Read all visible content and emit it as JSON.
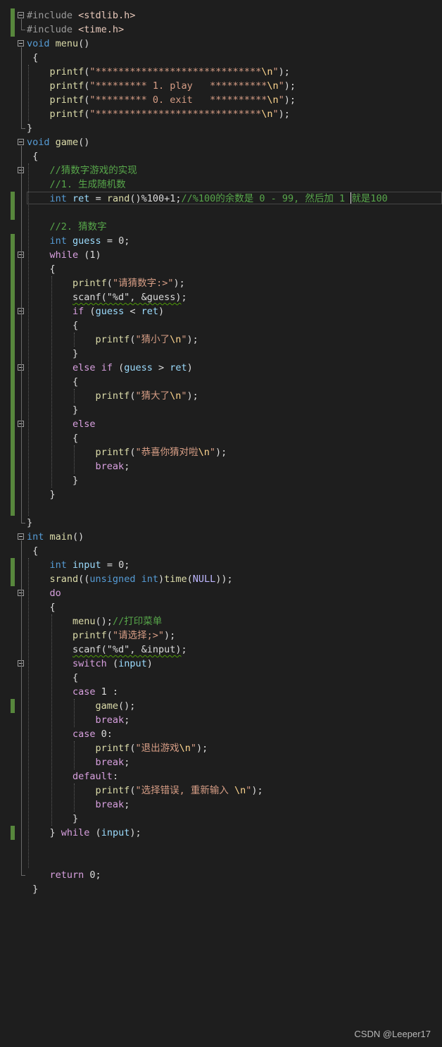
{
  "lines": [
    {
      "tokens": [
        {
          "t": "#include ",
          "c": "pp"
        },
        {
          "t": "<stdlib.h>",
          "c": "inc"
        }
      ],
      "fold": true,
      "change": true
    },
    {
      "tokens": [
        {
          "t": "#include ",
          "c": "pp"
        },
        {
          "t": "<time.h>",
          "c": "inc"
        }
      ],
      "change": true
    },
    {
      "tokens": [
        {
          "t": "void",
          "c": "kw"
        },
        {
          "t": " ",
          "c": "pl"
        },
        {
          "t": "menu",
          "c": "fn"
        },
        {
          "t": "()",
          "c": "pl"
        }
      ],
      "fold": true
    },
    {
      "tokens": [
        {
          "t": " {",
          "c": "pl"
        }
      ]
    },
    {
      "tokens": [
        {
          "t": "    printf",
          "c": "fn"
        },
        {
          "t": "(",
          "c": "pl"
        },
        {
          "t": "\"*****************************",
          "c": "str"
        },
        {
          "t": "\\n",
          "c": "esc"
        },
        {
          "t": "\"",
          "c": "str"
        },
        {
          "t": ");",
          "c": "pl"
        }
      ]
    },
    {
      "tokens": [
        {
          "t": "    printf",
          "c": "fn"
        },
        {
          "t": "(",
          "c": "pl"
        },
        {
          "t": "\"********* 1. play   **********",
          "c": "str"
        },
        {
          "t": "\\n",
          "c": "esc"
        },
        {
          "t": "\"",
          "c": "str"
        },
        {
          "t": ");",
          "c": "pl"
        }
      ]
    },
    {
      "tokens": [
        {
          "t": "    printf",
          "c": "fn"
        },
        {
          "t": "(",
          "c": "pl"
        },
        {
          "t": "\"********* 0. exit   **********",
          "c": "str"
        },
        {
          "t": "\\n",
          "c": "esc"
        },
        {
          "t": "\"",
          "c": "str"
        },
        {
          "t": ");",
          "c": "pl"
        }
      ]
    },
    {
      "tokens": [
        {
          "t": "    printf",
          "c": "fn"
        },
        {
          "t": "(",
          "c": "pl"
        },
        {
          "t": "\"*****************************",
          "c": "str"
        },
        {
          "t": "\\n",
          "c": "esc"
        },
        {
          "t": "\"",
          "c": "str"
        },
        {
          "t": ");",
          "c": "pl"
        }
      ]
    },
    {
      "tokens": [
        {
          "t": "}",
          "c": "pl"
        }
      ]
    },
    {
      "tokens": [
        {
          "t": "void",
          "c": "kw"
        },
        {
          "t": " ",
          "c": "pl"
        },
        {
          "t": "game",
          "c": "fn"
        },
        {
          "t": "()",
          "c": "pl"
        }
      ],
      "fold": true
    },
    {
      "tokens": [
        {
          "t": " {",
          "c": "pl"
        }
      ]
    },
    {
      "tokens": [
        {
          "t": "    //猜数字游戏的实现",
          "c": "cmt"
        }
      ],
      "fold": true
    },
    {
      "tokens": [
        {
          "t": "    //1. 生成随机数",
          "c": "cmt"
        }
      ]
    },
    {
      "tokens": [
        {
          "t": "    ",
          "c": "pl"
        },
        {
          "t": "int",
          "c": "kw"
        },
        {
          "t": " ",
          "c": "pl"
        },
        {
          "t": "ret",
          "c": "var"
        },
        {
          "t": " = ",
          "c": "pl"
        },
        {
          "t": "rand",
          "c": "fn"
        },
        {
          "t": "()%100+1;",
          "c": "pl"
        },
        {
          "t": "//%100的余数是 0 - 99, 然后加 1 ",
          "c": "cmt"
        },
        {
          "t": "|",
          "c": "caret"
        },
        {
          "t": "就是100",
          "c": "cmt"
        }
      ],
      "change": true,
      "active": true
    },
    {
      "tokens": [],
      "change": true
    },
    {
      "tokens": [
        {
          "t": "    //2. 猜数字",
          "c": "cmt"
        }
      ]
    },
    {
      "tokens": [
        {
          "t": "    ",
          "c": "pl"
        },
        {
          "t": "int",
          "c": "kw"
        },
        {
          "t": " ",
          "c": "pl"
        },
        {
          "t": "guess",
          "c": "var"
        },
        {
          "t": " = 0;",
          "c": "pl"
        }
      ],
      "change": true
    },
    {
      "tokens": [
        {
          "t": "    ",
          "c": "pl"
        },
        {
          "t": "while",
          "c": "ctl"
        },
        {
          "t": " (1)",
          "c": "pl"
        }
      ],
      "fold": true,
      "change": true
    },
    {
      "tokens": [
        {
          "t": "    {",
          "c": "pl"
        }
      ],
      "change": true
    },
    {
      "tokens": [
        {
          "t": "        printf",
          "c": "fn"
        },
        {
          "t": "(",
          "c": "pl"
        },
        {
          "t": "\"请猜数字:>\"",
          "c": "str"
        },
        {
          "t": ");",
          "c": "pl"
        }
      ],
      "change": true
    },
    {
      "tokens": [
        {
          "t": "        ",
          "c": "pl"
        },
        {
          "t": "scanf(\"%d\", &guess)",
          "c": "sq"
        },
        {
          "t": ";",
          "c": "pl"
        }
      ],
      "change": true
    },
    {
      "tokens": [
        {
          "t": "        ",
          "c": "pl"
        },
        {
          "t": "if",
          "c": "ctl"
        },
        {
          "t": " (",
          "c": "pl"
        },
        {
          "t": "guess",
          "c": "var"
        },
        {
          "t": " < ",
          "c": "pl"
        },
        {
          "t": "ret",
          "c": "var"
        },
        {
          "t": ")",
          "c": "pl"
        }
      ],
      "fold": true,
      "change": true
    },
    {
      "tokens": [
        {
          "t": "        {",
          "c": "pl"
        }
      ],
      "change": true
    },
    {
      "tokens": [
        {
          "t": "            printf",
          "c": "fn"
        },
        {
          "t": "(",
          "c": "pl"
        },
        {
          "t": "\"猜小了",
          "c": "str"
        },
        {
          "t": "\\n",
          "c": "esc"
        },
        {
          "t": "\"",
          "c": "str"
        },
        {
          "t": ");",
          "c": "pl"
        }
      ],
      "change": true
    },
    {
      "tokens": [
        {
          "t": "        }",
          "c": "pl"
        }
      ],
      "change": true
    },
    {
      "tokens": [
        {
          "t": "        ",
          "c": "pl"
        },
        {
          "t": "else",
          "c": "ctl"
        },
        {
          "t": " ",
          "c": "pl"
        },
        {
          "t": "if",
          "c": "ctl"
        },
        {
          "t": " (",
          "c": "pl"
        },
        {
          "t": "guess",
          "c": "var"
        },
        {
          "t": " > ",
          "c": "pl"
        },
        {
          "t": "ret",
          "c": "var"
        },
        {
          "t": ")",
          "c": "pl"
        }
      ],
      "fold": true,
      "change": true
    },
    {
      "tokens": [
        {
          "t": "        {",
          "c": "pl"
        }
      ],
      "change": true
    },
    {
      "tokens": [
        {
          "t": "            printf",
          "c": "fn"
        },
        {
          "t": "(",
          "c": "pl"
        },
        {
          "t": "\"猜大了",
          "c": "str"
        },
        {
          "t": "\\n",
          "c": "esc"
        },
        {
          "t": "\"",
          "c": "str"
        },
        {
          "t": ");",
          "c": "pl"
        }
      ],
      "change": true
    },
    {
      "tokens": [
        {
          "t": "        }",
          "c": "pl"
        }
      ],
      "change": true
    },
    {
      "tokens": [
        {
          "t": "        ",
          "c": "pl"
        },
        {
          "t": "else",
          "c": "ctl"
        }
      ],
      "fold": true,
      "change": true
    },
    {
      "tokens": [
        {
          "t": "        {",
          "c": "pl"
        }
      ],
      "change": true
    },
    {
      "tokens": [
        {
          "t": "            printf",
          "c": "fn"
        },
        {
          "t": "(",
          "c": "pl"
        },
        {
          "t": "\"恭喜你猜对啦",
          "c": "str"
        },
        {
          "t": "\\n",
          "c": "esc"
        },
        {
          "t": "\"",
          "c": "str"
        },
        {
          "t": ");",
          "c": "pl"
        }
      ],
      "change": true
    },
    {
      "tokens": [
        {
          "t": "            ",
          "c": "pl"
        },
        {
          "t": "break",
          "c": "ctl"
        },
        {
          "t": ";",
          "c": "pl"
        }
      ],
      "change": true
    },
    {
      "tokens": [
        {
          "t": "        }",
          "c": "pl"
        }
      ],
      "change": true
    },
    {
      "tokens": [
        {
          "t": "    }",
          "c": "pl"
        }
      ],
      "change": true
    },
    {
      "tokens": [],
      "change": true
    },
    {
      "tokens": [
        {
          "t": "}",
          "c": "pl"
        }
      ]
    },
    {
      "tokens": [
        {
          "t": "int",
          "c": "kw"
        },
        {
          "t": " ",
          "c": "pl"
        },
        {
          "t": "main",
          "c": "fn"
        },
        {
          "t": "()",
          "c": "pl"
        }
      ],
      "fold": true
    },
    {
      "tokens": [
        {
          "t": " {",
          "c": "pl"
        }
      ]
    },
    {
      "tokens": [
        {
          "t": "    ",
          "c": "pl"
        },
        {
          "t": "int",
          "c": "kw"
        },
        {
          "t": " ",
          "c": "pl"
        },
        {
          "t": "input",
          "c": "var"
        },
        {
          "t": " = 0;",
          "c": "pl"
        }
      ],
      "change": true
    },
    {
      "tokens": [
        {
          "t": "    srand",
          "c": "fn"
        },
        {
          "t": "((",
          "c": "pl"
        },
        {
          "t": "unsigned",
          "c": "kw"
        },
        {
          "t": " ",
          "c": "pl"
        },
        {
          "t": "int",
          "c": "kw"
        },
        {
          "t": ")",
          "c": "pl"
        },
        {
          "t": "time",
          "c": "fn"
        },
        {
          "t": "(",
          "c": "pl"
        },
        {
          "t": "NULL",
          "c": "macro"
        },
        {
          "t": "));",
          "c": "pl"
        }
      ],
      "change": true
    },
    {
      "tokens": [
        {
          "t": "    ",
          "c": "pl"
        },
        {
          "t": "do",
          "c": "ctl"
        }
      ],
      "fold": true
    },
    {
      "tokens": [
        {
          "t": "    {",
          "c": "pl"
        }
      ]
    },
    {
      "tokens": [
        {
          "t": "        menu",
          "c": "fn"
        },
        {
          "t": "();",
          "c": "pl"
        },
        {
          "t": "//打印菜单",
          "c": "cmt"
        }
      ]
    },
    {
      "tokens": [
        {
          "t": "        printf",
          "c": "fn"
        },
        {
          "t": "(",
          "c": "pl"
        },
        {
          "t": "\"请选择;>\"",
          "c": "str"
        },
        {
          "t": ");",
          "c": "pl"
        }
      ]
    },
    {
      "tokens": [
        {
          "t": "        ",
          "c": "pl"
        },
        {
          "t": "scanf(\"%d\", &input)",
          "c": "sq"
        },
        {
          "t": ";",
          "c": "pl"
        }
      ]
    },
    {
      "tokens": [
        {
          "t": "        ",
          "c": "pl"
        },
        {
          "t": "switch",
          "c": "ctl"
        },
        {
          "t": " (",
          "c": "pl"
        },
        {
          "t": "input",
          "c": "var"
        },
        {
          "t": ")",
          "c": "pl"
        }
      ],
      "fold": true
    },
    {
      "tokens": [
        {
          "t": "        {",
          "c": "pl"
        }
      ]
    },
    {
      "tokens": [
        {
          "t": "        ",
          "c": "pl"
        },
        {
          "t": "case",
          "c": "ctl"
        },
        {
          "t": " 1 :",
          "c": "pl"
        }
      ]
    },
    {
      "tokens": [
        {
          "t": "            game",
          "c": "fn"
        },
        {
          "t": "();",
          "c": "pl"
        }
      ],
      "change": true
    },
    {
      "tokens": [
        {
          "t": "            ",
          "c": "pl"
        },
        {
          "t": "break",
          "c": "ctl"
        },
        {
          "t": ";",
          "c": "pl"
        }
      ]
    },
    {
      "tokens": [
        {
          "t": "        ",
          "c": "pl"
        },
        {
          "t": "case",
          "c": "ctl"
        },
        {
          "t": " 0:",
          "c": "pl"
        }
      ]
    },
    {
      "tokens": [
        {
          "t": "            printf",
          "c": "fn"
        },
        {
          "t": "(",
          "c": "pl"
        },
        {
          "t": "\"退出游戏",
          "c": "str"
        },
        {
          "t": "\\n",
          "c": "esc"
        },
        {
          "t": "\"",
          "c": "str"
        },
        {
          "t": ");",
          "c": "pl"
        }
      ]
    },
    {
      "tokens": [
        {
          "t": "            ",
          "c": "pl"
        },
        {
          "t": "break",
          "c": "ctl"
        },
        {
          "t": ";",
          "c": "pl"
        }
      ]
    },
    {
      "tokens": [
        {
          "t": "        ",
          "c": "pl"
        },
        {
          "t": "default",
          "c": "ctl"
        },
        {
          "t": ":",
          "c": "pl"
        }
      ]
    },
    {
      "tokens": [
        {
          "t": "            printf",
          "c": "fn"
        },
        {
          "t": "(",
          "c": "pl"
        },
        {
          "t": "\"选择错误, 重新输入 ",
          "c": "str"
        },
        {
          "t": "\\n",
          "c": "esc"
        },
        {
          "t": "\"",
          "c": "str"
        },
        {
          "t": ");",
          "c": "pl"
        }
      ]
    },
    {
      "tokens": [
        {
          "t": "            ",
          "c": "pl"
        },
        {
          "t": "break",
          "c": "ctl"
        },
        {
          "t": ";",
          "c": "pl"
        }
      ]
    },
    {
      "tokens": [
        {
          "t": "        }",
          "c": "pl"
        }
      ]
    },
    {
      "tokens": [
        {
          "t": "    } ",
          "c": "pl"
        },
        {
          "t": "while",
          "c": "ctl"
        },
        {
          "t": " (",
          "c": "pl"
        },
        {
          "t": "input",
          "c": "var"
        },
        {
          "t": ");",
          "c": "pl"
        }
      ],
      "change": true
    },
    {
      "tokens": []
    },
    {
      "tokens": []
    },
    {
      "tokens": [
        {
          "t": "    ",
          "c": "pl"
        },
        {
          "t": "return",
          "c": "ctl"
        },
        {
          "t": " 0;",
          "c": "pl"
        }
      ]
    },
    {
      "tokens": [
        {
          "t": " }",
          "c": "pl"
        }
      ]
    }
  ],
  "watermark": "CSDN @Leeper17",
  "colors": {
    "background": "#1e1e1e",
    "keyword": "#569cd6",
    "control": "#d8a0df",
    "string": "#d69d85",
    "escape": "#ffd68f",
    "comment": "#57a64a",
    "function": "#dcdcaa",
    "variable": "#9cdcfe",
    "change_bar": "#57873c"
  }
}
